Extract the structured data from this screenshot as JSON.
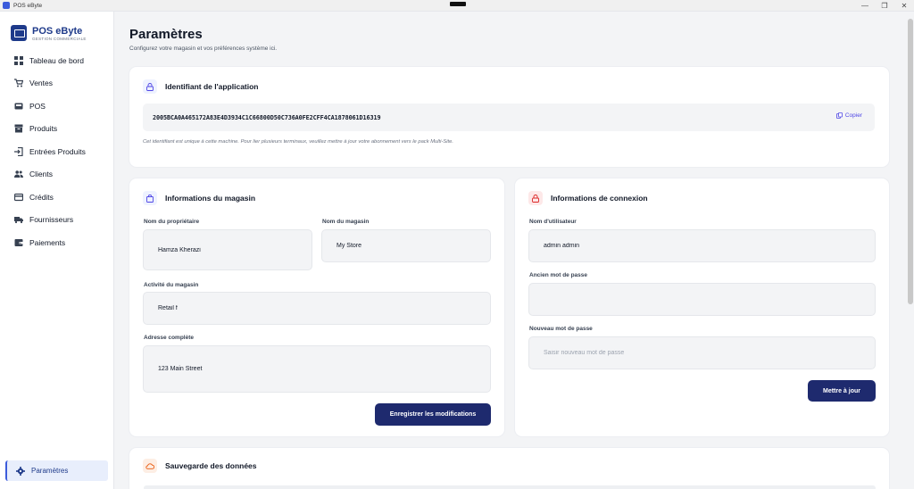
{
  "window": {
    "title": "POS eByte",
    "controls": [
      "—",
      "❐",
      "✕"
    ]
  },
  "brand": {
    "name": "POS eByte",
    "subtitle": "GESTION COMMERCIALE"
  },
  "sidebar": {
    "items": [
      {
        "label": "Tableau de bord",
        "icon": "dashboard-icon"
      },
      {
        "label": "Ventes",
        "icon": "cart-icon"
      },
      {
        "label": "POS",
        "icon": "pos-icon"
      },
      {
        "label": "Produits",
        "icon": "box-icon"
      },
      {
        "label": "Entrées Produits",
        "icon": "login-icon"
      },
      {
        "label": "Clients",
        "icon": "users-icon"
      },
      {
        "label": "Crédits",
        "icon": "credit-card-icon"
      },
      {
        "label": "Fournisseurs",
        "icon": "truck-icon"
      },
      {
        "label": "Paiements",
        "icon": "wallet-icon"
      }
    ],
    "active": {
      "label": "Paramètres",
      "icon": "gear-icon"
    }
  },
  "page": {
    "title": "Paramètres",
    "subtitle": "Configurez votre magasin et vos préférences système ici."
  },
  "app_id": {
    "title": "Identifiant de l'application",
    "value": "2005BCA0A465172A83E4D3934C1C66800D50C736A0FE2CFF4CA1878061D16319",
    "copy_label": "Copier",
    "note": "Cet identifiant est unique à cette machine. Pour lier plusieurs terminaux, veuillez mettre à jour votre abonnement vers le pack Multi-Site."
  },
  "store": {
    "title": "Informations du magasin",
    "owner_label": "Nom du propriétaire",
    "owner_value": "Hamza Kherazi",
    "store_label": "Nom du magasin",
    "store_value": "My Store",
    "activity_label": "Activité du magasin",
    "activity_value": "Retail f",
    "address_label": "Adresse complète",
    "address_value": "123 Main Street",
    "save_label": "Enregistrer les modifications"
  },
  "login": {
    "title": "Informations de connexion",
    "username_label": "Nom d'utilisateur",
    "username_value": "admin admin",
    "old_password_label": "Ancien mot de passe",
    "old_password_value": "",
    "new_password_label": "Nouveau mot de passe",
    "new_password_placeholder": "Saisir nouveau mot de passe",
    "update_label": "Mettre à jour"
  },
  "backup": {
    "title": "Sauvegarde des données"
  },
  "colors": {
    "primary": "#1e2a6e",
    "brand": "#1e3a8a",
    "accent": "#4f46e5",
    "id_icon_bg": "#eef2ff",
    "login_icon_bg": "#fde8e8",
    "backup_icon_bg": "#fdeee4"
  }
}
